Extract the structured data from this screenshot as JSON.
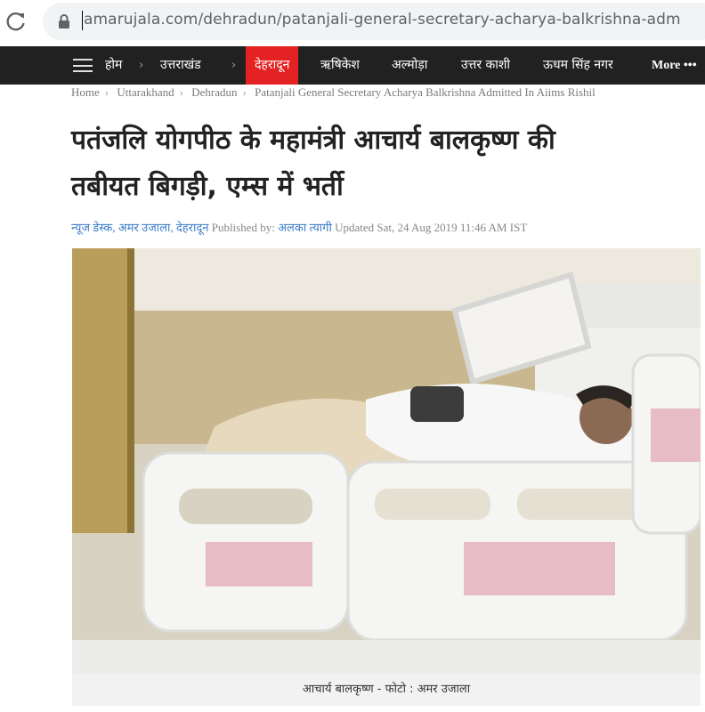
{
  "browser": {
    "url": "amarujala.com/dehradun/patanjali-general-secretary-acharya-balkrishna-adm"
  },
  "nav": {
    "items": [
      {
        "label": "होम"
      },
      {
        "label": "उत्तराखंड"
      },
      {
        "label": "देहरादून"
      },
      {
        "label": "ऋषिकेश"
      },
      {
        "label": "अल्मोड़ा"
      },
      {
        "label": "उत्तर काशी"
      },
      {
        "label": "ऊधम सिंह नगर"
      },
      {
        "label": "More •••"
      }
    ],
    "active_color": "#e42123"
  },
  "breadcrumb": {
    "items": [
      "Home",
      "Uttarakhand",
      "Dehradun",
      "Patanjali General Secretary Acharya Balkrishna Admitted In Aiims Rishil"
    ]
  },
  "article": {
    "headline_line1": "पतंजलि योगपीठ के महामंत्री आचार्य बालकृष्ण की",
    "headline_line2": "तबीयत बिगड़ी, एम्स में भर्ती",
    "author": "न्यूज डेस्क, अमर उजाला, देहरादून",
    "published_label": "Published by:",
    "publisher": "अलका त्यागी",
    "updated": "Updated Sat, 24 Aug 2019 11:46 AM IST",
    "photo_caption": "आचार्य बालकृष्ण - फोटो : अमर उजाला"
  },
  "colors": {
    "nav_bg": "#212121",
    "link": "#3a7bc8",
    "accent_red": "#e42123"
  }
}
